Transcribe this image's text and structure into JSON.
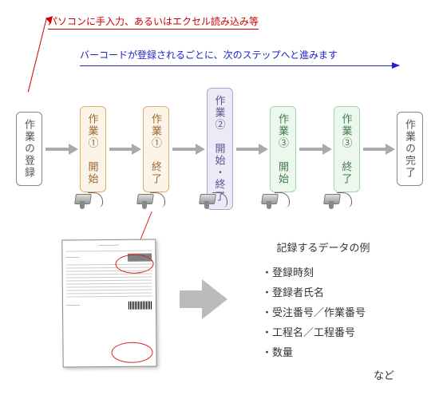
{
  "captions": {
    "top_red": "パソコンに手入力、あるいはエクセル読み込み等",
    "barcode_blue": "バーコードが登録されるごとに、次のステップへと進みます"
  },
  "flow": {
    "steps": [
      {
        "label": "作業の登録",
        "cls": "c-gray"
      },
      {
        "label": "作業①　開始",
        "cls": "c-orange"
      },
      {
        "label": "作業①　終了",
        "cls": "c-orange"
      },
      {
        "label": "作業②　開始・終了",
        "cls": "c-purple tall"
      },
      {
        "label": "作業③　開始",
        "cls": "c-green"
      },
      {
        "label": "作業③　終了",
        "cls": "c-green"
      },
      {
        "label": "作業の完了",
        "cls": "c-gray"
      }
    ]
  },
  "data_panel": {
    "title": "記録するデータの例",
    "items": [
      "登録時刻",
      "登録者氏名",
      "受注番号／作業番号",
      "工程名／工程番号",
      "数量"
    ],
    "etc": "など"
  }
}
